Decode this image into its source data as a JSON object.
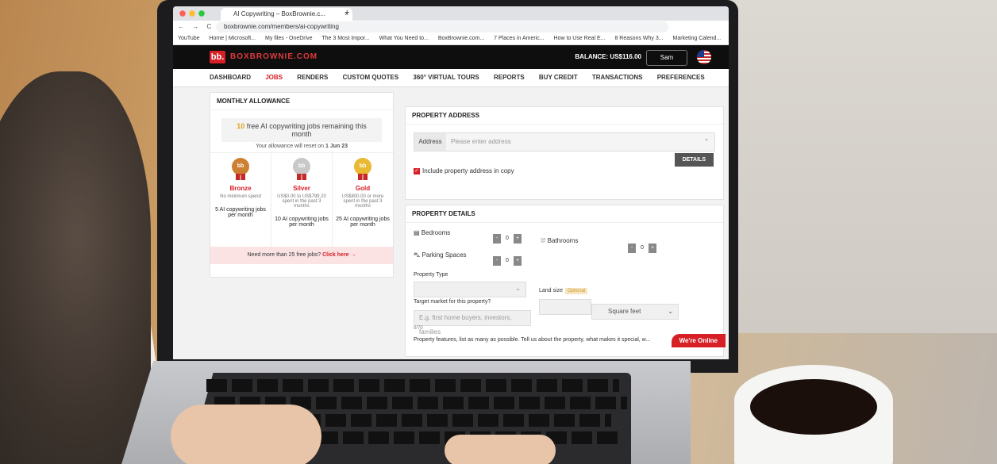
{
  "browser": {
    "tab_title": "AI Copywriting – BoxBrownie.c...",
    "tab_close": "×",
    "new_tab": "+",
    "nav_icons": "← → C",
    "url": "boxbrownie.com/members/ai-copywriting",
    "bookmarks": [
      "YouTube",
      "Home | Microsoft...",
      "My files - OneDrive",
      "The 3 Most Impor...",
      "What You Need to...",
      "BoxBrownie.com...",
      "7 Places in Americ...",
      "How to Use Real E...",
      "8 Reasons Why 3...",
      "Marketing Calend..."
    ]
  },
  "site": {
    "logo": "bb.",
    "brand": "BOXBROWNIE.COM",
    "balance": "BALANCE: US$116.00",
    "user": "Sam"
  },
  "nav": {
    "items": [
      "DASHBOARD",
      "JOBS",
      "RENDERS",
      "CUSTOM QUOTES",
      "360° VIRTUAL TOURS",
      "REPORTS",
      "BUY CREDIT",
      "TRANSACTIONS",
      "PREFERENCES"
    ]
  },
  "allowance": {
    "title": "MONTHLY ALLOWANCE",
    "count": "10",
    "banner_rest": " free AI copywriting jobs remaining this month",
    "reset_prefix": "Your allowance will reset on ",
    "reset_date": "1 Jun 23",
    "tiers": [
      {
        "medal": "bb",
        "name": "Bronze",
        "spend": "No minimum spend",
        "jobs": "5 AI copywriting jobs per month"
      },
      {
        "medal": "bb",
        "name": "Silver",
        "spend": "US$0.00 to US$799.20 spent in the past 3 months",
        "jobs": "10 AI copywriting jobs per month"
      },
      {
        "medal": "bb",
        "name": "Gold",
        "spend": "US$800.00 or more spent in the past 3 months",
        "jobs": "25 AI copywriting jobs per month"
      }
    ],
    "need_more": "Need more than 25 free jobs?",
    "click_here": "Click here →"
  },
  "address": {
    "title": "PROPERTY ADDRESS",
    "label": "Address",
    "placeholder": "Please enter address",
    "details_button": "DETAILS",
    "include_label": "Include property address in copy"
  },
  "details": {
    "title": "PROPERTY DETAILS",
    "bedrooms": "Bedrooms",
    "bathrooms": "Bathrooms",
    "parking": "Parking Spaces",
    "bedrooms_value": "0",
    "bathrooms_value": "0",
    "parking_value": "0",
    "minus": "-",
    "plus": "+",
    "property_type": "Property Type",
    "land_size": "Land size",
    "optional": "Optional",
    "square_feet": "Square feet",
    "target_market": "Target market for this property?",
    "target_placeholder": "E.g. first home buyers, investors, families",
    "char_count": "0/70",
    "features_label": "Property features, list as many as possible. Tell us about the property, what makes it special, w..."
  },
  "chat": {
    "label": "We're Online"
  }
}
